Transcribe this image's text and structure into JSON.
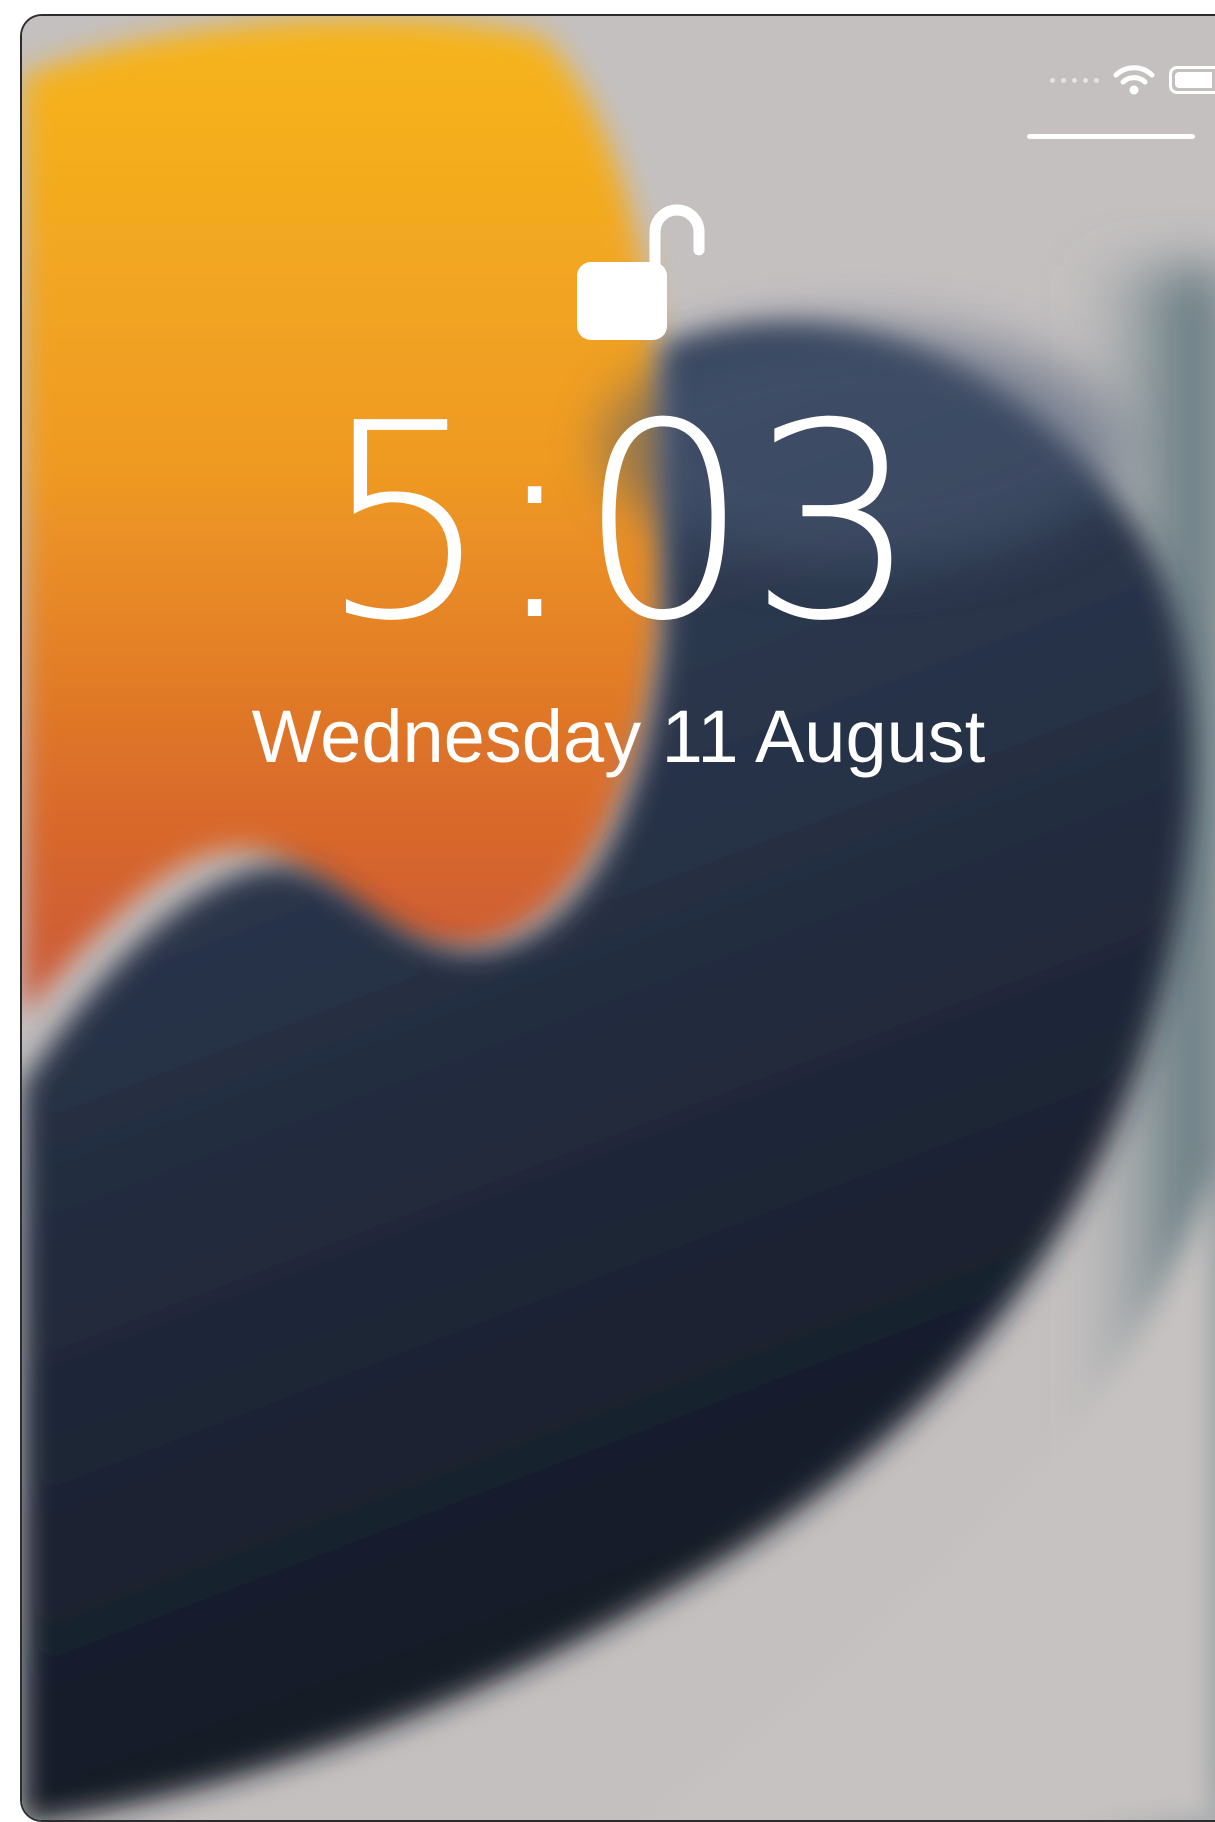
{
  "lock_screen": {
    "time": "5:03",
    "date": "Wednesday 11 August",
    "lock_state": "unlocked",
    "lock_icon": "unlocked-padlock-icon"
  },
  "status_bar": {
    "wifi_icon": "wifi-icon",
    "battery_icon": "battery-icon",
    "signal_icon": "cellular-signal-dots-icon"
  },
  "wallpaper": {
    "colors": {
      "background": "#c3bfbf",
      "orange_top": "#f2b21c",
      "orange_bottom": "#d8651f",
      "navy_light": "#3a4a63",
      "navy_dark": "#141a26",
      "teal_edge": "#4f6b73"
    }
  }
}
